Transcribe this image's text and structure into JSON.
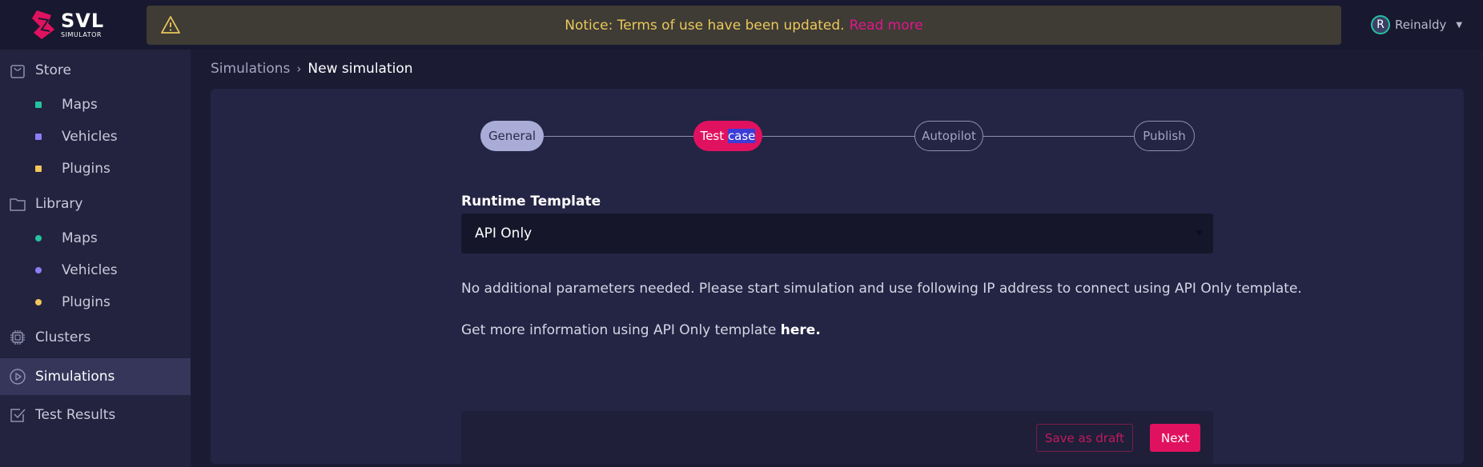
{
  "brand": {
    "name": "SVL",
    "subtitle": "SIMULATOR"
  },
  "notice": {
    "text": "Notice: Terms of use have been updated.",
    "link": "Read more",
    "icon": "warning-triangle-icon"
  },
  "user": {
    "initial": "R",
    "name": "Reinaldy"
  },
  "sidebar": {
    "store": {
      "label": "Store",
      "icon": "bag-icon"
    },
    "store_items": [
      {
        "label": "Maps",
        "color": "#25c2a0"
      },
      {
        "label": "Vehicles",
        "color": "#8e7df5"
      },
      {
        "label": "Plugins",
        "color": "#f0c75a"
      }
    ],
    "library": {
      "label": "Library",
      "icon": "folder-icon"
    },
    "library_items": [
      {
        "label": "Maps",
        "color": "#25c2a0"
      },
      {
        "label": "Vehicles",
        "color": "#8e7df5"
      },
      {
        "label": "Plugins",
        "color": "#f0c75a"
      }
    ],
    "clusters": {
      "label": "Clusters",
      "icon": "chip-icon"
    },
    "simulations": {
      "label": "Simulations",
      "icon": "play-circle-icon"
    },
    "test_results": {
      "label": "Test Results",
      "icon": "checkbox-icon"
    }
  },
  "breadcrumb": {
    "parent": "Simulations",
    "separator": "›",
    "current": "New simulation"
  },
  "stepper": {
    "steps": [
      {
        "label": "General",
        "state": "done"
      },
      {
        "label_a": "Test ",
        "label_b": "case",
        "state": "current"
      },
      {
        "label": "Autopilot",
        "state": "pending"
      },
      {
        "label": "Publish",
        "state": "pending"
      }
    ]
  },
  "form": {
    "runtime_label": "Runtime Template",
    "runtime_value": "API Only",
    "info_text": "No additional parameters needed. Please start simulation and use following IP address to connect using API Only template.",
    "more_text": "Get more information using API Only template ",
    "more_link": "here."
  },
  "actions": {
    "draft": "Save as draft",
    "next": "Next"
  },
  "colors": {
    "accent": "#e0125f",
    "notice_text": "#e9c85a",
    "notice_link": "#e0168c"
  }
}
